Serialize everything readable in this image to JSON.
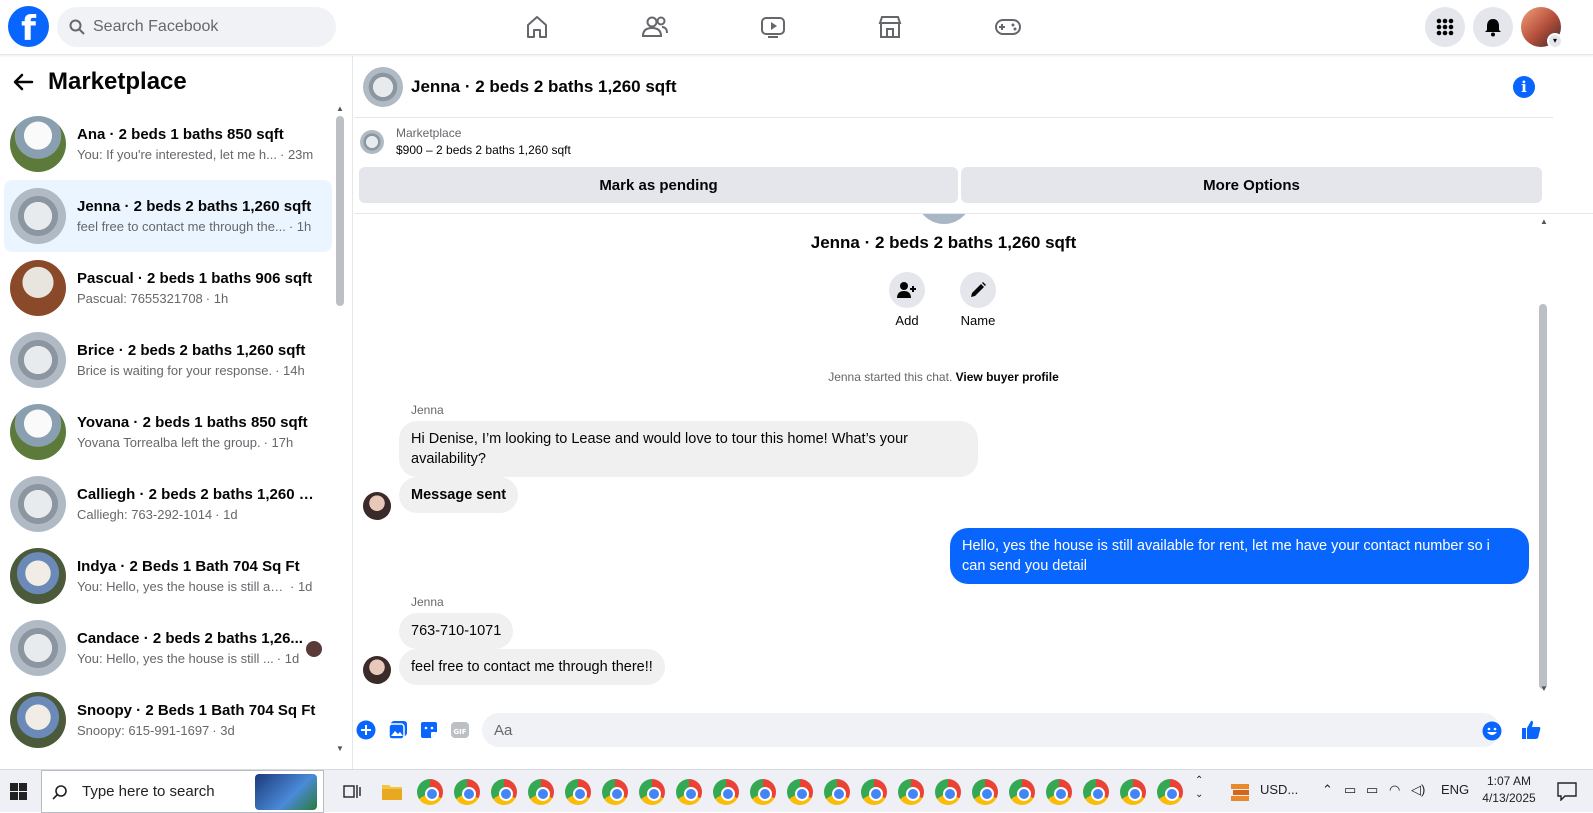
{
  "topbar": {
    "logo": "f",
    "search_placeholder": "Search Facebook",
    "nav_icons": [
      "home-icon",
      "friends-icon",
      "video-icon",
      "marketplace-icon",
      "gaming-icon"
    ],
    "right_icons": [
      "menu-grid-icon",
      "notifications-bell-icon",
      "profile-avatar"
    ]
  },
  "sidebar": {
    "title": "Marketplace",
    "conversations": [
      {
        "title": "Ana · 2 beds 1 baths 850 sqft",
        "snippet": "You: If you're interested, let me h...",
        "time": "· 23m"
      },
      {
        "title": "Jenna · 2 beds 2 baths 1,260 sqft",
        "snippet": "feel free to contact me through the...",
        "time": "· 1h"
      },
      {
        "title": "Pascual · 2 beds 1 baths 906 sqft",
        "snippet": "Pascual: 7655321708",
        "time": "· 1h"
      },
      {
        "title": "Brice · 2 beds 2 baths 1,260 sqft",
        "snippet": "Brice is waiting for your response.",
        "time": "· 14h"
      },
      {
        "title": "Yovana · 2 beds 1 baths 850 sqft",
        "snippet": "Yovana Torrealba left the group.",
        "time": "· 17h"
      },
      {
        "title": "Calliegh · 2 beds 2 baths 1,260 s...",
        "snippet": "Calliegh: 763-292-1014",
        "time": "· 1d"
      },
      {
        "title": "Indya · 2 Beds 1 Bath 704 Sq Ft",
        "snippet": "You: Hello, yes the house is still ava...",
        "time": "· 1d"
      },
      {
        "title": "Candace · 2 beds 2 baths 1,26...",
        "snippet": "You: Hello, yes the house is still ...",
        "time": "· 1d"
      },
      {
        "title": "Snoopy · 2 Beds 1 Bath 704 Sq Ft",
        "snippet": "Snoopy: 615-991-1697",
        "time": "· 3d"
      }
    ]
  },
  "chat": {
    "header_title": "Jenna · 2 beds 2 baths 1,260 sqft",
    "listing_label": "Marketplace",
    "listing_price": "$900 – 2 beds 2 baths 1,260 sqft",
    "mark_pending": "Mark as pending",
    "more_options": "More Options",
    "profile_name": "Jenna · 2 beds 2 baths 1,260 sqft",
    "add_label": "Add",
    "name_label": "Name",
    "system_text": "Jenna started this chat.",
    "view_buyer_profile": "View buyer profile",
    "sender1": "Jenna",
    "msg1": "Hi Denise, I’m looking to Lease and would love to tour this home! What’s your availability?",
    "msg2": "Message sent",
    "msg3": "Hello, yes the house is still available for rent, let me have your contact number so i can send you detail",
    "sender2": "Jenna",
    "msg4": "763-710-1071",
    "msg5": "feel free to contact me through there!!",
    "input_placeholder": "Aa"
  },
  "taskbar": {
    "search_text": "Type here to search",
    "currency": "USD...",
    "lang": "ENG",
    "time": "1:07 AM",
    "date": "4/13/2025"
  },
  "colors": {
    "brand": "#0866ff",
    "active_row": "#ebf5ff",
    "bubble_in": "#f0f0f0"
  }
}
